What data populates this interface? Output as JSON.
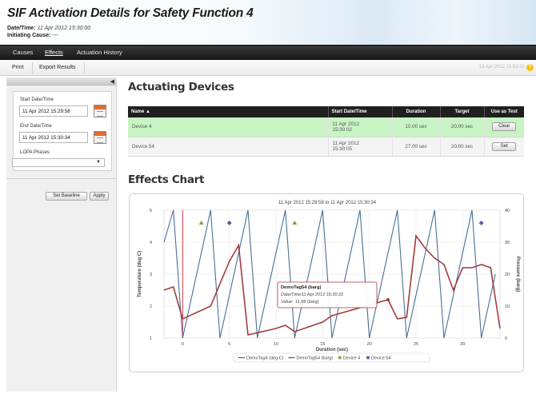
{
  "page": {
    "title": "SIF Activation Details for Safety Function 4",
    "datetime_label": "Date/Time:",
    "datetime_value": "11 Apr 2012 15:30:00",
    "cause_label": "Initiating Cause:",
    "cause_value": "---"
  },
  "nav": {
    "causes": "Causes",
    "effects": "Effects",
    "history": "Actuation History"
  },
  "toolbar": {
    "print": "Print",
    "export": "Export Results",
    "timestamp": "13 Apr 2012 15:52:01",
    "help_icon": "help-icon"
  },
  "sidebar": {
    "collapse_icon": "triangle-left-icon",
    "start_label": "Start Date/Time",
    "start_value": "11 Apr 2012 15:29:58",
    "end_label": "End Date/Time",
    "end_value": "11 Apr 2012 15:30:34",
    "lopa_label": "LOPA Phases",
    "lopa_value": "",
    "set_baseline": "Set Baseline",
    "apply": "Apply"
  },
  "devices": {
    "title": "Actuating Devices",
    "columns": [
      "Name ▲",
      "Start Date/Time",
      "Duration",
      "Target",
      "Use as Test"
    ],
    "rows": [
      {
        "name": "Device 4",
        "start_line1": "11 Apr 2012",
        "start_line2": "15:30:02",
        "duration": "10.00 sec",
        "target": "20.00 sec",
        "action": "Clear",
        "highlight": true
      },
      {
        "name": "Device 54",
        "start_line1": "11 Apr 2012",
        "start_line2": "15:30:05",
        "duration": "27.00 sec",
        "target": "20.00 sec",
        "action": "Set",
        "highlight": false
      }
    ]
  },
  "effects": {
    "title": "Effects Chart"
  },
  "chart_data": {
    "type": "line",
    "title": "11 Apr 2012 15:29:58 to 11 Apr 2012 15:30:34",
    "xlabel": "Duration (sec)",
    "ylabel": "Temperature (deg C)",
    "y2label": "Pressure (barg)",
    "xlim": [
      -2,
      34
    ],
    "ylim": [
      1,
      5
    ],
    "y2lim": [
      0,
      40
    ],
    "xticks": [
      0,
      5,
      10,
      15,
      20,
      25,
      30
    ],
    "yticks": [
      1,
      2,
      3,
      4,
      5
    ],
    "y2ticks": [
      0,
      10,
      20,
      30,
      40
    ],
    "grid": true,
    "marker_line_x": 0,
    "series": [
      {
        "name": "DemoTag4 (deg C)",
        "axis": "left",
        "color": "#4a6f96",
        "x": [
          -2,
          -1,
          0,
          3,
          4,
          7,
          8,
          11,
          12,
          15,
          16,
          19,
          20,
          23,
          24,
          27,
          28,
          31,
          32,
          33.5
        ],
        "y": [
          4,
          5,
          1,
          5,
          1,
          5,
          1,
          5,
          1,
          5,
          1,
          5,
          1,
          5,
          1,
          5,
          1,
          5,
          1,
          3
        ]
      },
      {
        "name": "DemoTag54 (barg)",
        "axis": "right",
        "color": "#a33c3c",
        "x": [
          -2,
          -1,
          0,
          3,
          5,
          6,
          7,
          10,
          11,
          12,
          15,
          16,
          22,
          23,
          24,
          25,
          26,
          27,
          28,
          29,
          30,
          31,
          32,
          33,
          34
        ],
        "y": [
          15,
          16,
          6,
          10,
          24,
          29,
          1,
          3,
          4,
          2,
          5,
          7,
          12,
          6,
          6.5,
          32,
          28,
          25,
          23,
          15,
          22,
          22,
          23,
          22,
          3
        ]
      },
      {
        "name": "Device 4",
        "type": "marker",
        "color": "#7ea53a",
        "points": [
          [
            2,
            4.6
          ],
          [
            12,
            4.6
          ]
        ]
      },
      {
        "name": "Device 54",
        "type": "marker",
        "color": "#6a55a8",
        "points": [
          [
            5,
            4.6
          ],
          [
            32,
            4.6
          ]
        ]
      }
    ],
    "tooltip": {
      "series": "DemoTag54 (barg)",
      "datetime_label": "Date/Time:",
      "datetime_value": "11 Apr 2012 15:30:22",
      "value_label": "Value:",
      "value": "11.58 (barg)"
    },
    "legend_position": "bottom"
  }
}
